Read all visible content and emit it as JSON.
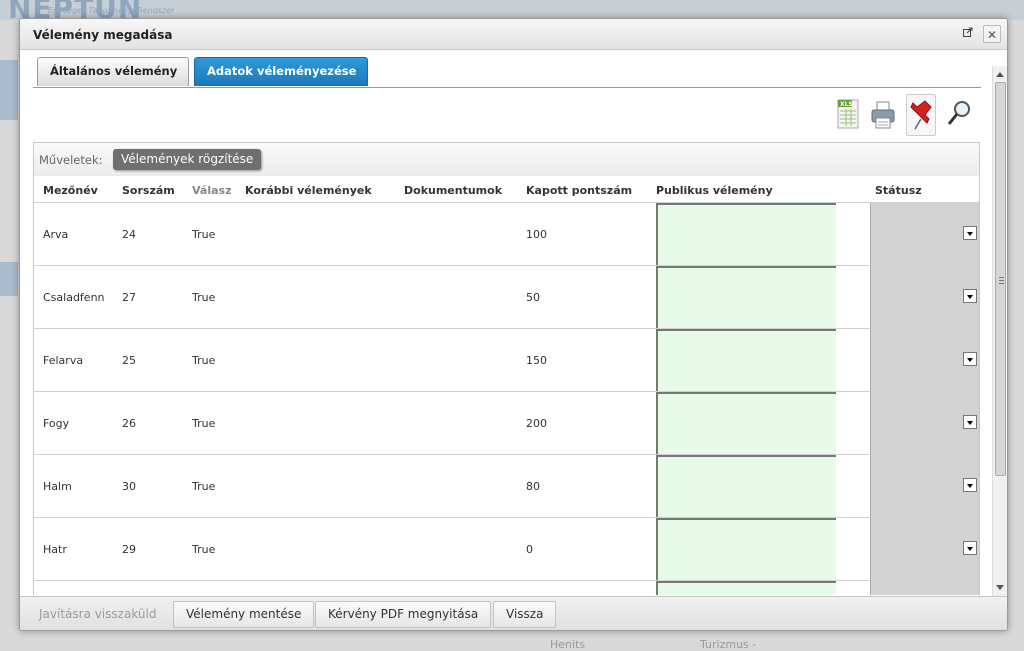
{
  "background": {
    "logo": "NEPTUN",
    "logo_sub": "Egységes Tanulmányi Rendszer",
    "bottom_texts": [
      "Henits",
      "Turizmus -"
    ]
  },
  "modal": {
    "title": "Vélemény megadása",
    "tabs": [
      {
        "label": "Általános vélemény",
        "active": false
      },
      {
        "label": "Adatok véleményezése",
        "active": true
      }
    ],
    "toolbar_icons": [
      "excel-export-icon",
      "print-icon",
      "pin-icon",
      "search-icon"
    ],
    "operations": {
      "label": "Műveletek:",
      "button": "Vélemények rögzítése"
    },
    "columns": {
      "field_name": "Mezőnév",
      "serial": "Sorszám",
      "answer": "Válasz",
      "previous": "Korábbi vélemények",
      "documents": "Dokumentumok",
      "points": "Kapott pontszám",
      "public_opinion": "Publikus vélemény",
      "status": "Státusz"
    },
    "rows": [
      {
        "field": "Arva",
        "serial": "24",
        "answer": "True",
        "points": "100"
      },
      {
        "field": "Csaladfenn",
        "serial": "27",
        "answer": "True",
        "points": "50"
      },
      {
        "field": "Felarva",
        "serial": "25",
        "answer": "True",
        "points": "150"
      },
      {
        "field": "Fogy",
        "serial": "26",
        "answer": "True",
        "points": "200"
      },
      {
        "field": "Halm",
        "serial": "30",
        "answer": "True",
        "points": "80"
      },
      {
        "field": "Hatr",
        "serial": "29",
        "answer": "True",
        "points": "0"
      },
      {
        "field": "",
        "serial": "",
        "answer": "",
        "points": ""
      }
    ],
    "footer_buttons": {
      "send_back": "Javításra visszaküld",
      "save": "Vélemény mentése",
      "open_pdf": "Kérvény PDF megnyitása",
      "back": "Vissza"
    },
    "colors": {
      "active_tab": "#1b78bd",
      "public_cell": "#e8fae8",
      "status_cell": "#d3d3d3"
    }
  }
}
